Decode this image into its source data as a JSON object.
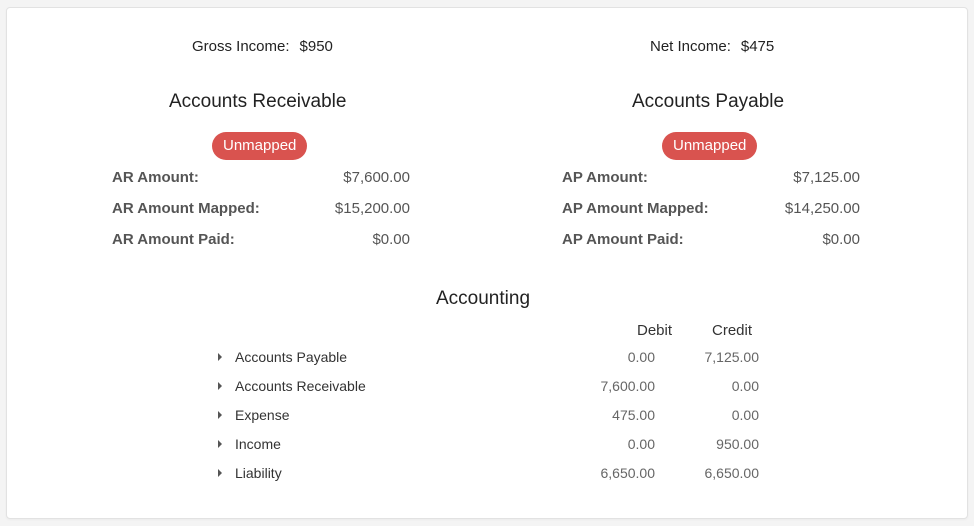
{
  "summary": {
    "gross_label": "Gross Income:",
    "gross_value": "$950",
    "net_label": "Net Income:",
    "net_value": "$475"
  },
  "receivable": {
    "title": "Accounts Receivable",
    "badge": "Unmapped",
    "rows": [
      {
        "label": "AR Amount:",
        "value": "$7,600.00"
      },
      {
        "label": "AR Amount Mapped:",
        "value": "$15,200.00"
      },
      {
        "label": "AR Amount Paid:",
        "value": "$0.00"
      }
    ]
  },
  "payable": {
    "title": "Accounts Payable",
    "badge": "Unmapped",
    "rows": [
      {
        "label": "AP Amount:",
        "value": "$7,125.00"
      },
      {
        "label": "AP Amount Mapped:",
        "value": "$14,250.00"
      },
      {
        "label": "AP Amount Paid:",
        "value": "$0.00"
      }
    ]
  },
  "accounting": {
    "title": "Accounting",
    "headers": {
      "debit": "Debit",
      "credit": "Credit"
    },
    "rows": [
      {
        "name": "Accounts Payable",
        "debit": "0.00",
        "credit": "7,125.00"
      },
      {
        "name": "Accounts Receivable",
        "debit": "7,600.00",
        "credit": "0.00"
      },
      {
        "name": "Expense",
        "debit": "475.00",
        "credit": "0.00"
      },
      {
        "name": "Income",
        "debit": "0.00",
        "credit": "950.00"
      },
      {
        "name": "Liability",
        "debit": "6,650.00",
        "credit": "6,650.00"
      }
    ]
  },
  "colors": {
    "badge": "#d9534f",
    "card_bg": "#ffffff",
    "page_bg": "#f4f4f4"
  },
  "icons": {
    "row_toggle": "caret-right-icon"
  }
}
